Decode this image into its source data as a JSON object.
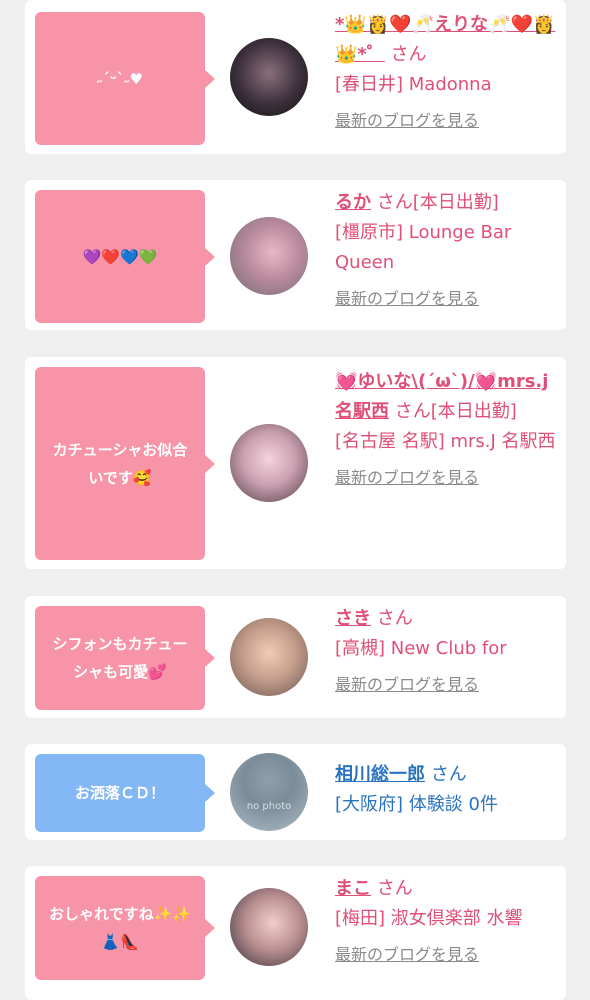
{
  "entries": [
    {
      "comment": "˶ˊᵕˋ˶♥",
      "name": "*👑👸❤️🥂えりな🥂❤️👸👑*゜",
      "suffix": "さん",
      "shop": "[春日井] Madonna",
      "blog_link": "最新のブログを見る",
      "bubble_color": "#f894a8"
    },
    {
      "comment": "💜❤️💙💚",
      "name": "るか",
      "suffix": "さん[本日出勤]",
      "shop": "[橿原市] Lounge Bar Queen",
      "blog_link": "最新のブログを見る",
      "bubble_color": "#f894a8"
    },
    {
      "comment": "カチューシャお似合いです🥰",
      "name": "💓ゆいな\\(´ω`)/💓mrs.j名駅西",
      "suffix": "さん[本日出勤]",
      "shop": "[名古屋 名駅] mrs.J 名駅西",
      "blog_link": "最新のブログを見る",
      "bubble_color": "#f894a8"
    },
    {
      "comment": "シフォンもカチューシャも可愛💕",
      "name": "さき",
      "suffix": "さん",
      "shop": "[高槻] New Club for",
      "blog_link": "最新のブログを見る",
      "bubble_color": "#f894a8"
    },
    {
      "comment": "お洒落ＣＤ！",
      "name": "相川総一郎",
      "suffix": "さん",
      "shop": "[大阪府] 体験談 0件",
      "bubble_color": "#83b7f5",
      "avatar_text": "no photo"
    },
    {
      "comment": "おしゃれですね✨✨👗👠",
      "name": "まこ",
      "suffix": "さん",
      "shop": "[梅田] 淑女倶楽部 水響",
      "blog_link": "最新のブログを見る",
      "bubble_color": "#f894a8"
    }
  ]
}
